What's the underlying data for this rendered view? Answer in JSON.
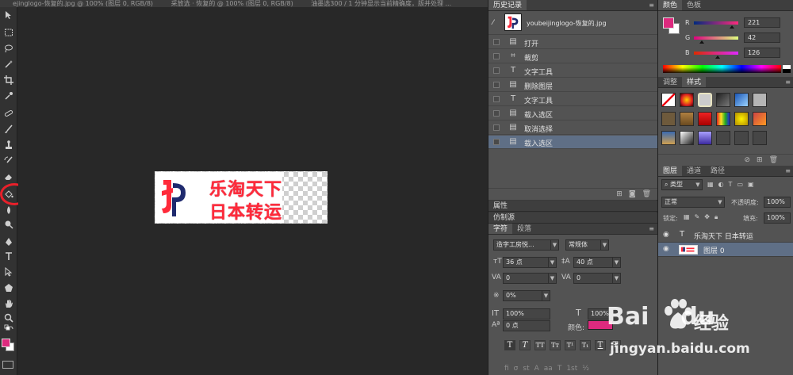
{
  "document": {
    "title_text": "ejingloɡo-恢复的.jpg @ 100% (图层 0, RGB/8)",
    "title_text2": "采放选 · 恢复的 @ 100% (图层 0, RGB/8)",
    "title_text3": "油墨选300 / 1 分钟显示当前精确度，版并处理 ..."
  },
  "canvas": {
    "brand_line1": "乐淘天下",
    "brand_line2": "日本转运",
    "logo_letters": "JP"
  },
  "history_panel": {
    "tab_label": "历史记录",
    "snapshot_label": "youbeijinglogo-恢复的.jpg",
    "items": [
      {
        "label": "打开",
        "icon": "document-icon"
      },
      {
        "label": "裁剪",
        "icon": "crop-icon"
      },
      {
        "label": "文字工具",
        "icon": "type-icon"
      },
      {
        "label": "删除图层",
        "icon": "document-icon"
      },
      {
        "label": "文字工具",
        "icon": "type-icon"
      },
      {
        "label": "载入选区",
        "icon": "document-icon"
      },
      {
        "label": "取消选择",
        "icon": "document-icon"
      },
      {
        "label": "载入选区",
        "icon": "document-icon"
      }
    ],
    "selected_index": 7
  },
  "collapsed_panels": {
    "properties": "属性",
    "clone_source": "仿制源"
  },
  "character_panel": {
    "tab_character": "字符",
    "tab_paragraph": "段落",
    "font_family": "造字工房悦...",
    "font_style": "常规体",
    "font_size": "36 点",
    "leading": "40 点",
    "kerning": "0",
    "tracking": "0",
    "scale_percent": "0%",
    "vertical_scale": "100%",
    "horizontal_scale": "100%",
    "baseline_shift": "0 点",
    "color_label": "颜色:",
    "color_value": "#dd2a7e",
    "style_buttons": [
      "T",
      "T",
      "TT",
      "Tт",
      "T¹",
      "T₁",
      "T",
      "Ŧ"
    ],
    "opentype_buttons": [
      "fi",
      "σ",
      "st",
      "A",
      "aa",
      "T",
      "1st",
      "½"
    ]
  },
  "color_panel": {
    "tab_color": "颜色",
    "tab_swatches": "色板",
    "foreground": "#dd2a7e",
    "r_label": "R",
    "g_label": "G",
    "b_label": "B",
    "r_value": "221",
    "g_value": "42",
    "b_value": "126"
  },
  "styles_panel": {
    "tab_adjust": "调整",
    "tab_styles": "样式"
  },
  "layers_panel": {
    "tab_layers": "图层",
    "tab_channels": "通道",
    "tab_paths": "路径",
    "filter_kind": "类型",
    "blend_mode": "正常",
    "opacity_label": "不透明度:",
    "opacity_value": "100%",
    "lock_label": "锁定:",
    "fill_label": "填充:",
    "fill_value": "100%",
    "layers": [
      {
        "name": "乐淘天下 日本转运",
        "type": "text"
      },
      {
        "name": "图层 0",
        "type": "pixel"
      }
    ]
  },
  "watermark": {
    "brand": "Bai",
    "brand_suffix": "du",
    "product": "经验",
    "url": "jingyan.baidu.com"
  }
}
